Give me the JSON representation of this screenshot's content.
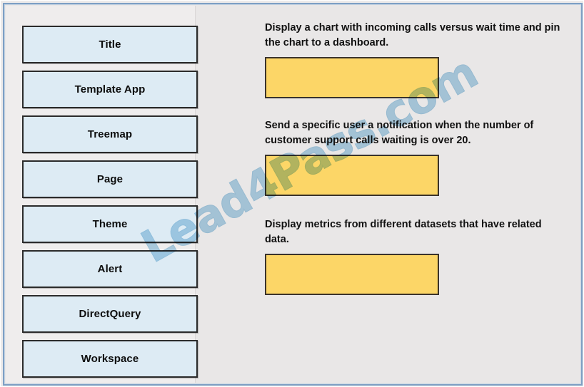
{
  "question": {
    "type": "drag-and-drop-matching",
    "watermark": "Lead4Pass.com"
  },
  "colors": {
    "term_fill": "#DDEBF4",
    "term_border": "#2B2B2B",
    "answer_fill": "#FCD667",
    "answer_border": "#3A332C",
    "canvas_background": "#E9E7E7",
    "left_panel_background": "#EFEDED",
    "frame_border": "#7D9FC4",
    "watermark_color": "#9ECBE6"
  },
  "terms_panel": {
    "name": "answer-choices",
    "items": [
      {
        "label": "Title"
      },
      {
        "label": "Template App"
      },
      {
        "label": "Treemap"
      },
      {
        "label": "Page"
      },
      {
        "label": "Theme"
      },
      {
        "label": "Alert"
      },
      {
        "label": "DirectQuery"
      },
      {
        "label": "Workspace"
      }
    ]
  },
  "tasks_panel": {
    "name": "task-statements",
    "items": [
      {
        "text": "Display a chart with incoming calls versus wait time and pin the chart to a dashboard.",
        "answer_value": ""
      },
      {
        "text": "Send a specific user a notification when the number of customer support calls waiting is over 20.",
        "answer_value": ""
      },
      {
        "text": "Display metrics from different datasets that have related data.",
        "answer_value": ""
      }
    ]
  }
}
